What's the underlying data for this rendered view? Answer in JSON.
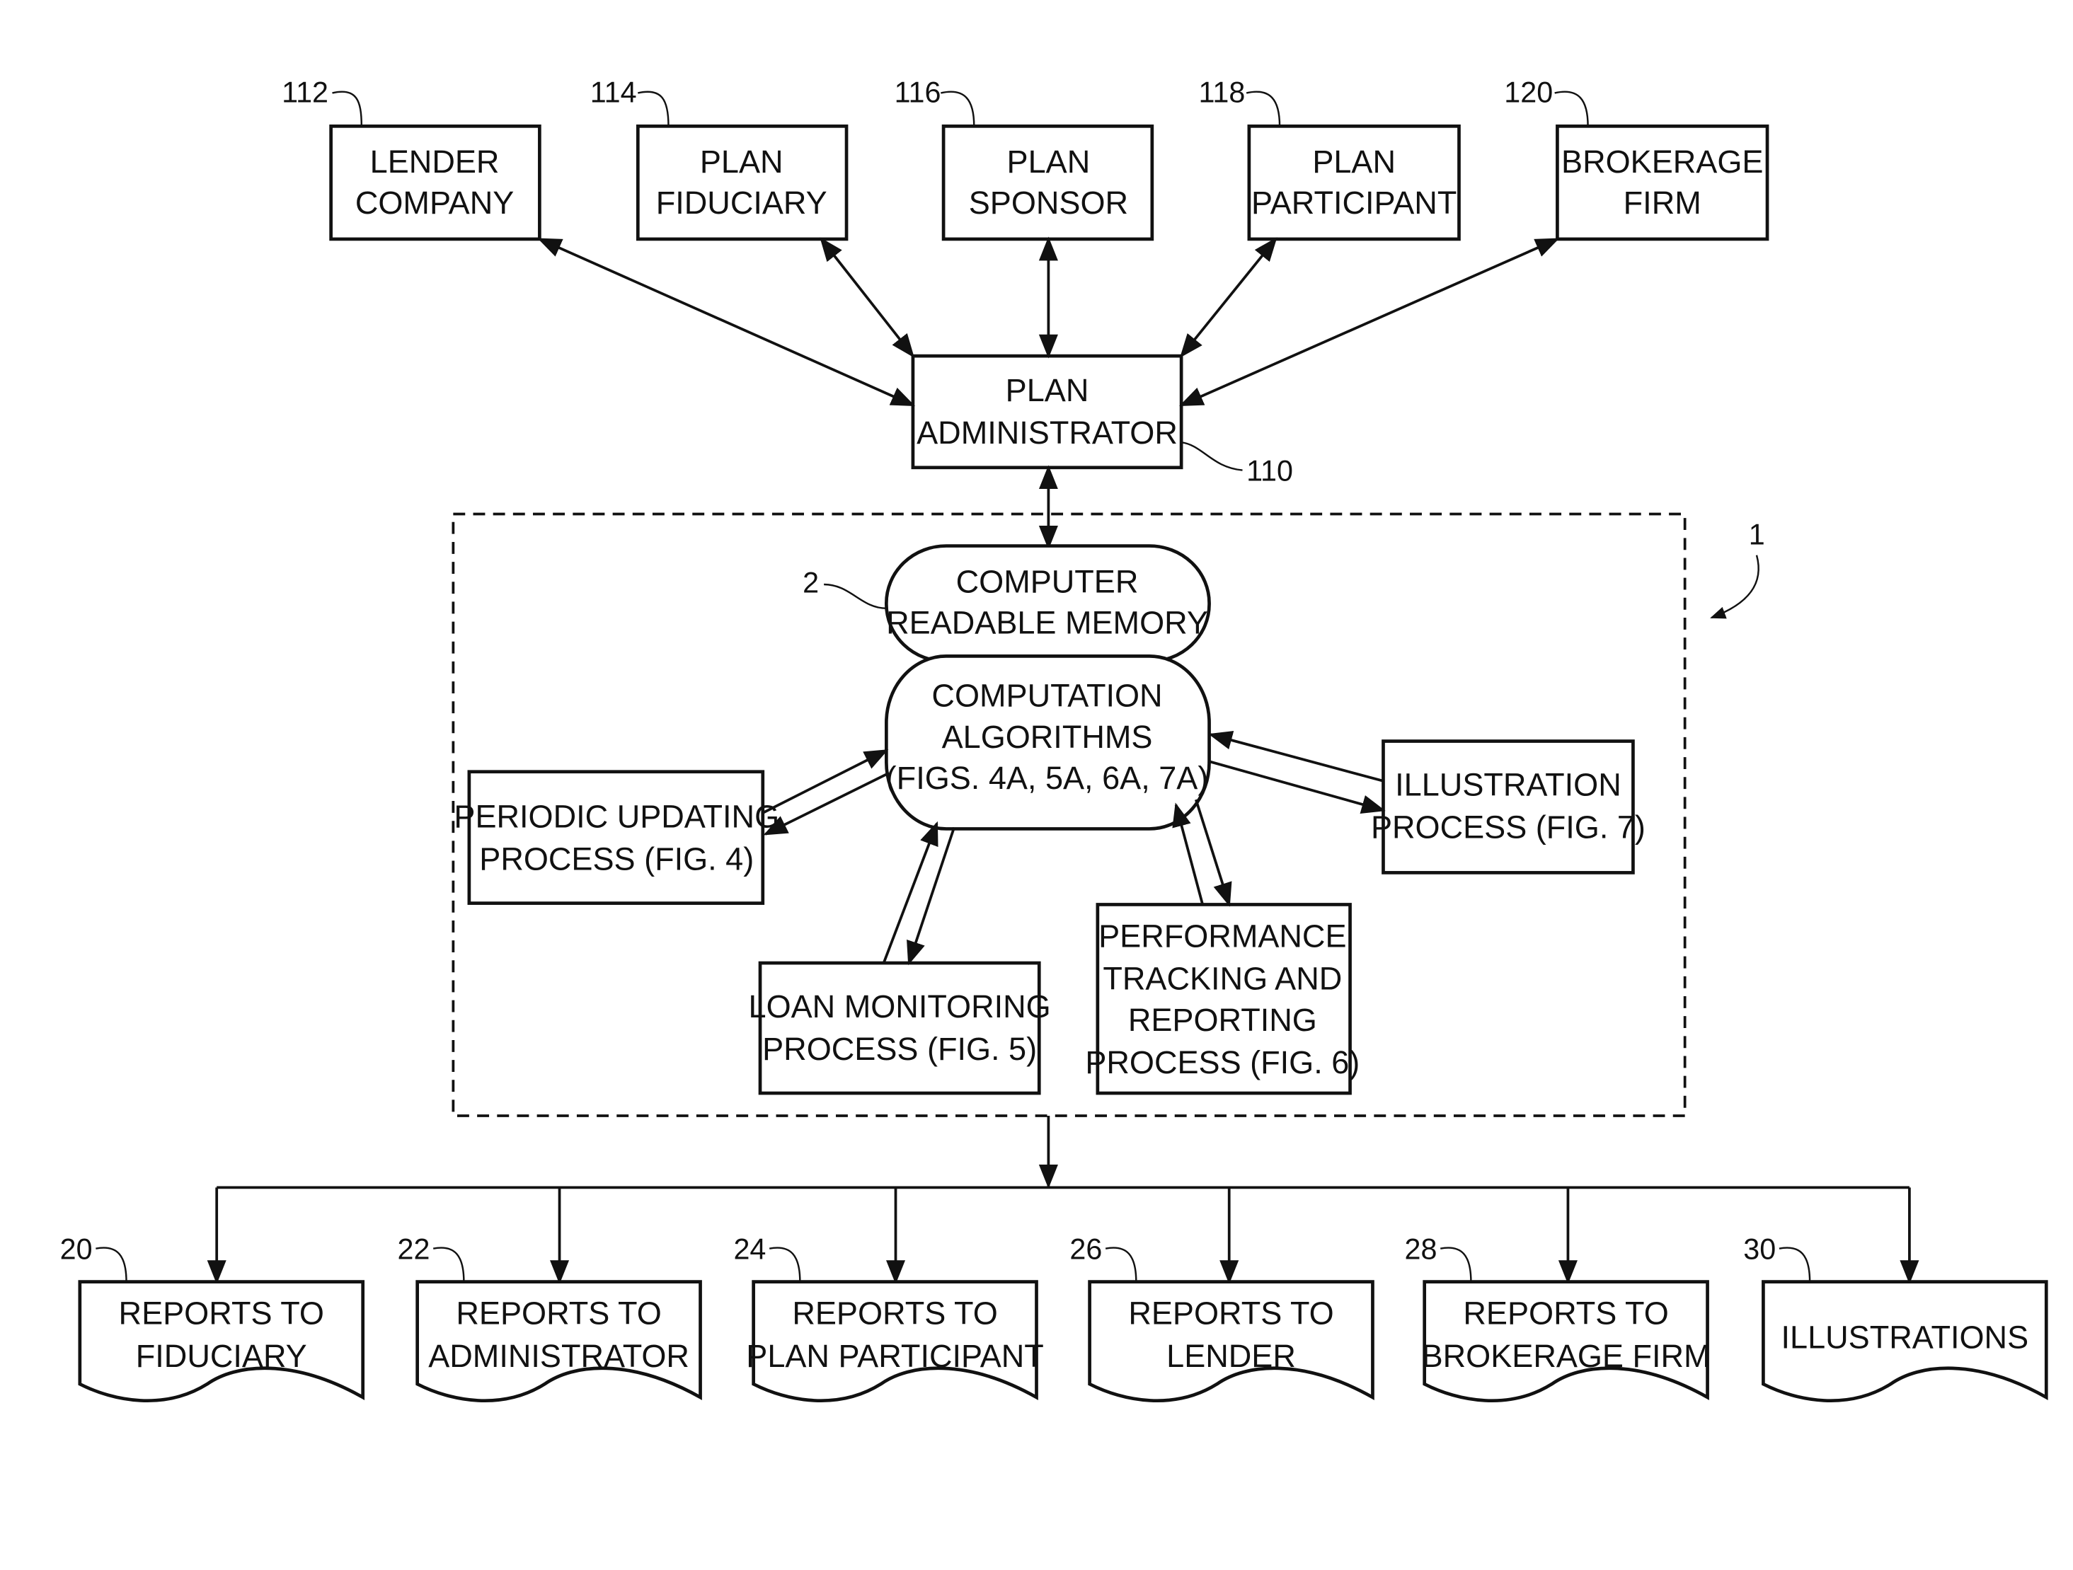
{
  "figure": {
    "system_ref": "1",
    "top_entities": [
      {
        "ref": "112",
        "lines": [
          "LENDER",
          "COMPANY"
        ]
      },
      {
        "ref": "114",
        "lines": [
          "PLAN",
          "FIDUCIARY"
        ]
      },
      {
        "ref": "116",
        "lines": [
          "PLAN",
          "SPONSOR"
        ]
      },
      {
        "ref": "118",
        "lines": [
          "PLAN",
          "PARTICIPANT"
        ]
      },
      {
        "ref": "120",
        "lines": [
          "BROKERAGE",
          "FIRM"
        ]
      }
    ],
    "administrator": {
      "ref": "110",
      "lines": [
        "PLAN",
        "ADMINISTRATOR"
      ]
    },
    "memory": {
      "ref": "2",
      "lines": [
        "COMPUTER",
        "READABLE MEMORY"
      ]
    },
    "algorithms": {
      "lines": [
        "COMPUTATION",
        "ALGORITHMS",
        "(FIGS. 4A, 5A, 6A, 7A)"
      ]
    },
    "processes": {
      "periodic": [
        "PERIODIC UPDATING",
        "PROCESS (FIG. 4)"
      ],
      "loan": [
        "LOAN MONITORING",
        "PROCESS (FIG. 5)"
      ],
      "performance": [
        "PERFORMANCE",
        "TRACKING AND",
        "REPORTING",
        "PROCESS (FIG. 6)"
      ],
      "illustration": [
        "ILLUSTRATION",
        "PROCESS (FIG. 7)"
      ]
    },
    "reports": [
      {
        "ref": "20",
        "lines": [
          "REPORTS TO",
          "FIDUCIARY"
        ]
      },
      {
        "ref": "22",
        "lines": [
          "REPORTS TO",
          "ADMINISTRATOR"
        ]
      },
      {
        "ref": "24",
        "lines": [
          "REPORTS TO",
          "PLAN PARTICIPANT"
        ]
      },
      {
        "ref": "26",
        "lines": [
          "REPORTS TO",
          "LENDER"
        ]
      },
      {
        "ref": "28",
        "lines": [
          "REPORTS TO",
          "BROKERAGE FIRM"
        ]
      },
      {
        "ref": "30",
        "lines": [
          "ILLUSTRATIONS"
        ]
      }
    ]
  }
}
